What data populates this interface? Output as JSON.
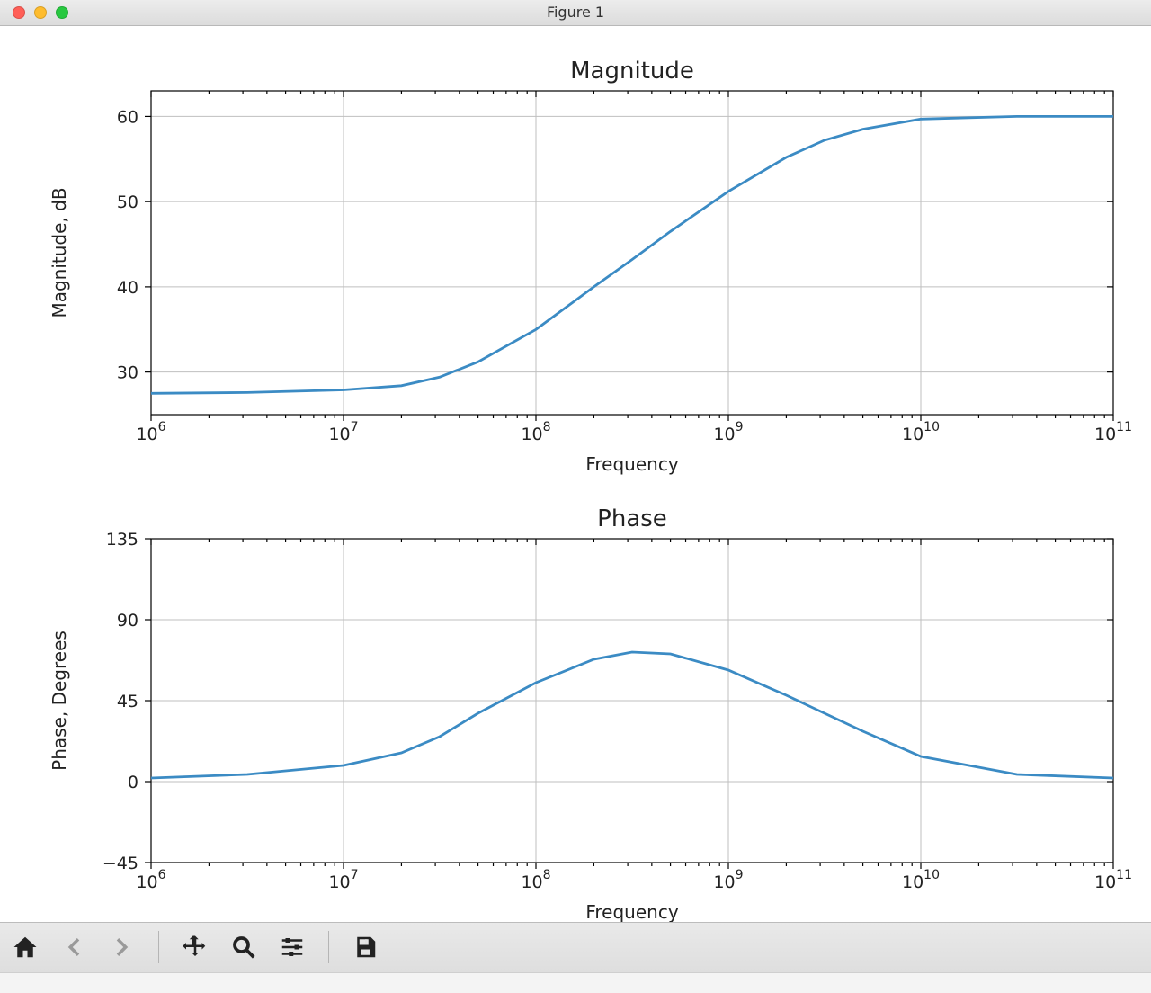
{
  "window": {
    "title": "Figure 1"
  },
  "toolbar": {
    "items": [
      {
        "name": "home-button",
        "icon": "home-icon",
        "interactable": true
      },
      {
        "name": "back-button",
        "icon": "arrow-left-icon",
        "interactable": false
      },
      {
        "name": "forward-button",
        "icon": "arrow-right-icon",
        "interactable": false
      },
      {
        "name": "pan-button",
        "icon": "move-icon",
        "interactable": true
      },
      {
        "name": "zoom-button",
        "icon": "zoom-icon",
        "interactable": true
      },
      {
        "name": "configure-subplots-button",
        "icon": "sliders-icon",
        "interactable": true
      },
      {
        "name": "save-button",
        "icon": "save-icon",
        "interactable": true
      }
    ]
  },
  "chart_data": [
    {
      "type": "line",
      "title": "Magnitude",
      "xlabel": "Frequency",
      "ylabel": "Magnitude, dB",
      "xscale": "log",
      "xlim": [
        1000000.0,
        100000000000.0
      ],
      "ylim": [
        25,
        63
      ],
      "xticks_exp": [
        6,
        7,
        8,
        9,
        10,
        11
      ],
      "yticks": [
        30,
        40,
        50,
        60
      ],
      "grid": true,
      "series": [
        {
          "name": "magnitude",
          "color": "#3b8bc4",
          "x": [
            1000000.0,
            3160000.0,
            10000000.0,
            20000000.0,
            31600000.0,
            50000000.0,
            100000000.0,
            200000000.0,
            316000000.0,
            500000000.0,
            1000000000.0,
            2000000000.0,
            3160000000.0,
            5000000000.0,
            10000000000.0,
            31600000000.0,
            100000000000.0
          ],
          "y": [
            27.5,
            27.6,
            27.9,
            28.4,
            29.4,
            31.2,
            35.0,
            40.0,
            43.2,
            46.5,
            51.2,
            55.2,
            57.2,
            58.5,
            59.7,
            60.0,
            60.0
          ]
        }
      ]
    },
    {
      "type": "line",
      "title": "Phase",
      "xlabel": "Frequency",
      "ylabel": "Phase, Degrees",
      "xscale": "log",
      "xlim": [
        1000000.0,
        100000000000.0
      ],
      "ylim": [
        -45,
        135
      ],
      "xticks_exp": [
        6,
        7,
        8,
        9,
        10,
        11
      ],
      "yticks": [
        -45,
        0,
        45,
        90,
        135
      ],
      "grid": true,
      "series": [
        {
          "name": "phase",
          "color": "#3b8bc4",
          "x": [
            1000000.0,
            3160000.0,
            10000000.0,
            20000000.0,
            31600000.0,
            50000000.0,
            100000000.0,
            200000000.0,
            316000000.0,
            500000000.0,
            1000000000.0,
            2000000000.0,
            3160000000.0,
            5000000000.0,
            10000000000.0,
            31600000000.0,
            100000000000.0
          ],
          "y": [
            2,
            4,
            9,
            16,
            25,
            38,
            55,
            68,
            72,
            71,
            62,
            48,
            38,
            28,
            14,
            4,
            2
          ]
        }
      ]
    }
  ]
}
